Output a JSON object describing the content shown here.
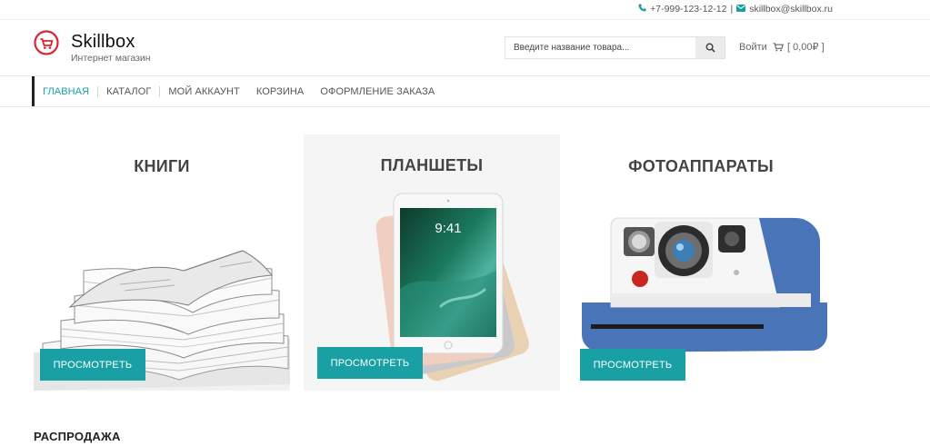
{
  "colors": {
    "accent": "#18a0a4",
    "logo_red": "#d7262f"
  },
  "topbar": {
    "phone": "+7-999-123-12-12",
    "divider": "|",
    "email": "skillbox@skillbox.ru",
    "phone_icon": "phone-icon",
    "email_icon": "envelope-icon"
  },
  "header": {
    "brand": "Skillbox",
    "tagline": "Интернет магазин",
    "logo_icon": "cart-logo-icon",
    "search": {
      "placeholder": "Введите название товара...",
      "value": "",
      "icon": "search-icon"
    },
    "login_label": "Войти",
    "cart_label": "[ 0,00₽ ]",
    "cart_icon": "cart-icon"
  },
  "nav": {
    "items": [
      {
        "label": "ГЛАВНАЯ",
        "active": true
      },
      {
        "label": "КАТАЛОГ"
      },
      {
        "label": "МОЙ АККАУНТ"
      },
      {
        "label": "КОРЗИНА"
      },
      {
        "label": "ОФОРМЛЕНИЕ ЗАКАЗА"
      }
    ]
  },
  "categories": [
    {
      "title": "КНИГИ",
      "button": "ПРОСМОТРЕТЬ",
      "image": "books-image"
    },
    {
      "title": "ПЛАНШЕТЫ",
      "button": "ПРОСМОТРЕТЬ",
      "image": "tablet-image",
      "clock": "9:41"
    },
    {
      "title": "ФОТОАППАРАТЫ",
      "button": "ПРОСМОТРЕТЬ",
      "image": "camera-image"
    }
  ],
  "sale": {
    "title": "РАСПРОДАЖА"
  }
}
